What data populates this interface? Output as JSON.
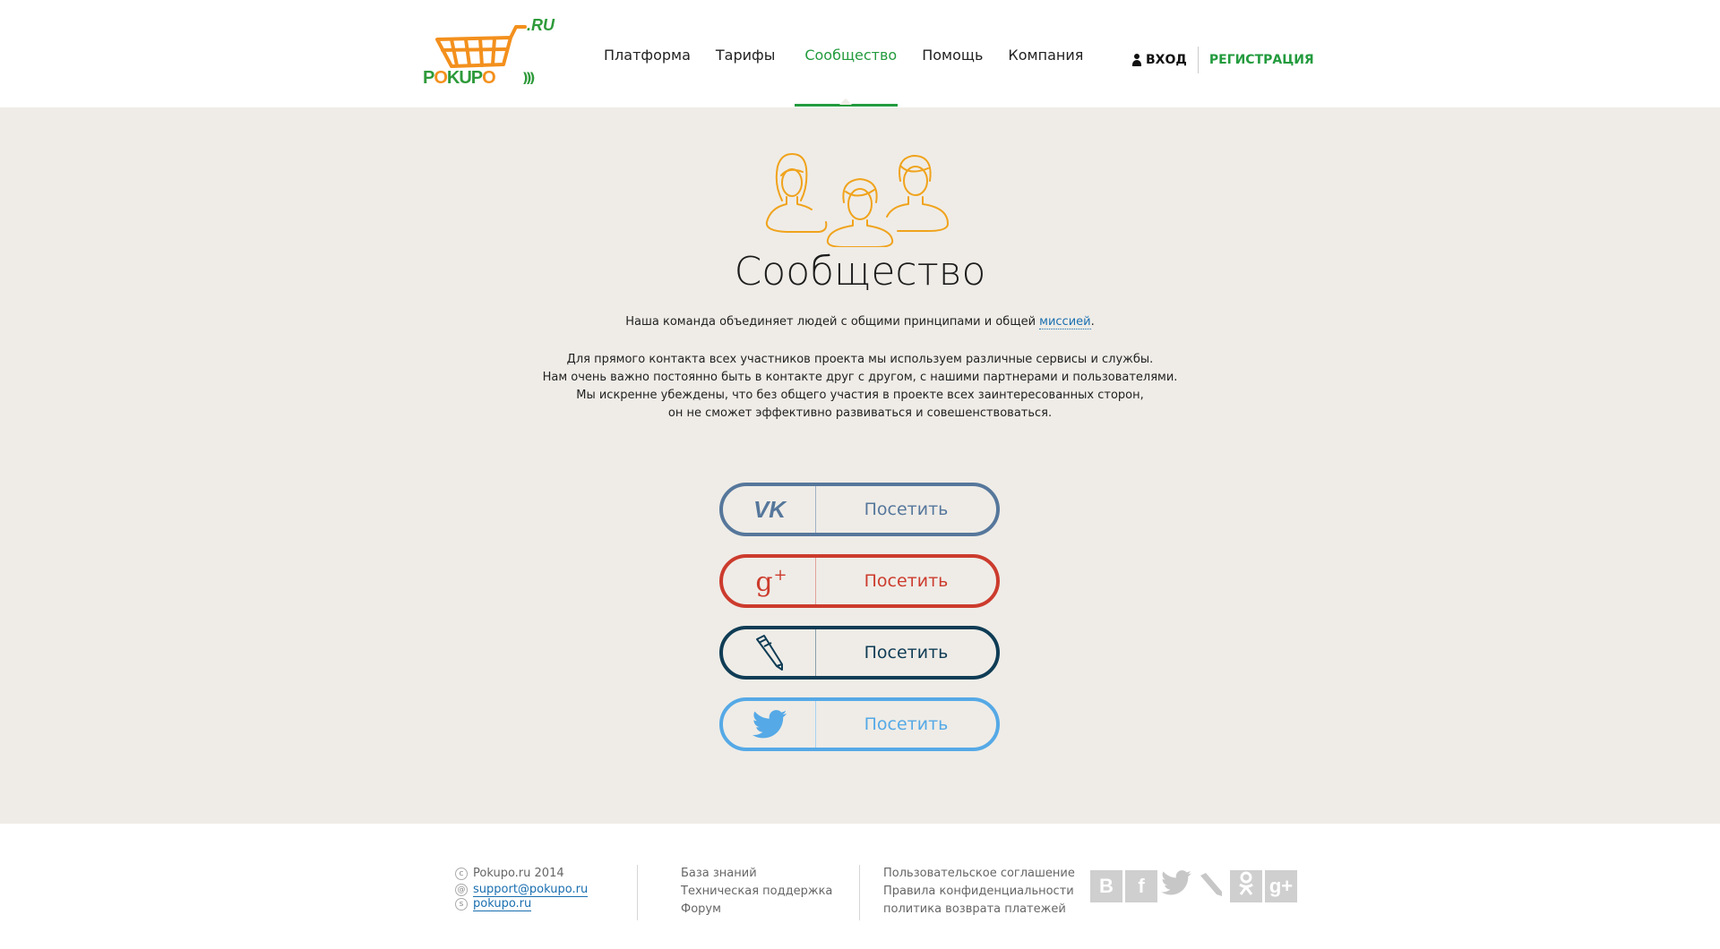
{
  "header": {
    "logo": {
      "ru": ".RU",
      "word_g": "P",
      "word_o": "O",
      "word_rest_g": "KUP",
      "word_end_o": "O",
      "waves": ")))"
    },
    "nav": [
      {
        "label": "Платформа",
        "active": false
      },
      {
        "label": "Тарифы",
        "active": false
      },
      {
        "label": "Сообщество",
        "active": true
      },
      {
        "label": "Помощь",
        "active": false
      },
      {
        "label": "Компания",
        "active": false
      }
    ],
    "login_label": "ВХОД",
    "register_label": "РЕГИСТРАЦИЯ"
  },
  "main": {
    "title": "Сообщество",
    "intro_text": "Наша команда объединяет людей с общими принципами и общей ",
    "intro_link": "миссией",
    "intro_end": ".",
    "desc_lines": [
      "Для прямого контакта всех участников проекта мы используем различные сервисы и службы.",
      "Нам очень важно постоянно быть в контакте друг с другом, с нашими партнерами и пользователями.",
      "Мы искренне убеждены, что без общего участия в проекте всех заинтересованных сторон,",
      "он не сможет эффективно развиваться и совешенствоваться."
    ],
    "social_buttons": [
      {
        "icon": "vk-icon",
        "label": "Посетить",
        "color": "#56779b"
      },
      {
        "icon": "google-plus-icon",
        "label": "Посетить",
        "color": "#cc3b2d"
      },
      {
        "icon": "livejournal-icon",
        "label": "Посетить",
        "color": "#0f3c55"
      },
      {
        "icon": "twitter-icon",
        "label": "Посетить",
        "color": "#55a9e6"
      }
    ],
    "icon_color": "#f0a31c"
  },
  "footer": {
    "copyright": "Pokupo.ru 2014",
    "email": "support@pokupo.ru",
    "skype": "pokupo.ru",
    "col2": [
      "База знаний",
      "Техническая поддержка",
      "Форум"
    ],
    "col3": [
      "Пользовательское соглашение",
      "Правила конфиденциальности",
      "политика возврата платежей"
    ],
    "social_icons": [
      "vk-icon",
      "facebook-icon",
      "twitter-icon",
      "livejournal-icon",
      "odnoklassniki-icon",
      "google-plus-icon"
    ],
    "social_glyphs": [
      "B",
      "f",
      "",
      "",
      "",
      "g+"
    ]
  },
  "colors": {
    "accent": "#239b3e",
    "background": "#efece7"
  }
}
